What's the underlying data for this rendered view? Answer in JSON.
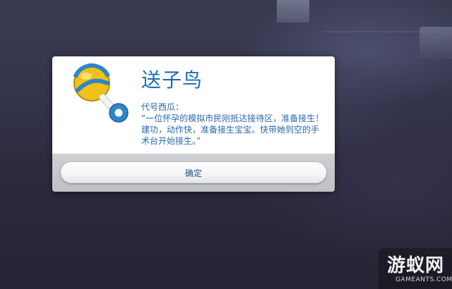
{
  "dialog": {
    "title": "送子鸟",
    "speaker": "代号西瓜：",
    "message": "“一位怀孕的模拟市民刚抵达接待区，准备接生！建功，动作快，准备接生宝宝。快带她到空的手术台开始接生。”",
    "confirm_label": "确定",
    "icon": "baby-rattle-icon"
  },
  "watermark": {
    "name": "游蚁网",
    "site": "GAMEANTS.COM"
  },
  "colors": {
    "title": "#1d6db2",
    "text": "#2a69ab",
    "button_text": "#2a4f88"
  }
}
